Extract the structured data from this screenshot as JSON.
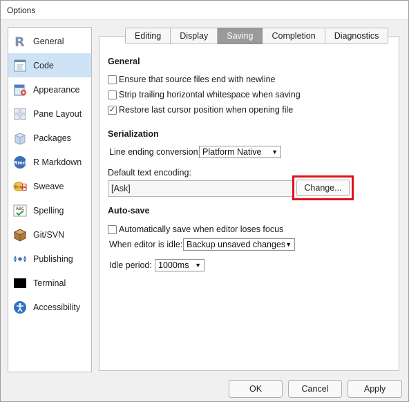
{
  "window": {
    "title": "Options"
  },
  "sidebar": {
    "items": [
      {
        "label": "General",
        "icon": "r-logo-icon"
      },
      {
        "label": "Code",
        "icon": "code-icon",
        "selected": true
      },
      {
        "label": "Appearance",
        "icon": "appearance-icon"
      },
      {
        "label": "Pane Layout",
        "icon": "pane-layout-icon"
      },
      {
        "label": "Packages",
        "icon": "packages-icon"
      },
      {
        "label": "R Markdown",
        "icon": "rmd-icon"
      },
      {
        "label": "Sweave",
        "icon": "sweave-icon"
      },
      {
        "label": "Spelling",
        "icon": "spelling-icon"
      },
      {
        "label": "Git/SVN",
        "icon": "git-box-icon"
      },
      {
        "label": "Publishing",
        "icon": "publishing-icon"
      },
      {
        "label": "Terminal",
        "icon": "terminal-icon"
      },
      {
        "label": "Accessibility",
        "icon": "accessibility-icon"
      }
    ],
    "rmd_icon_text": "Rmd",
    "rnw_icon_text": "Rnw",
    "abc_icon_text": "ABC"
  },
  "tabs": [
    {
      "label": "Editing"
    },
    {
      "label": "Display"
    },
    {
      "label": "Saving",
      "active": true
    },
    {
      "label": "Completion"
    },
    {
      "label": "Diagnostics"
    }
  ],
  "general": {
    "title": "General",
    "options": [
      {
        "label": "Ensure that source files end with newline",
        "checked": false
      },
      {
        "label": "Strip trailing horizontal whitespace when saving",
        "checked": false
      },
      {
        "label": "Restore last cursor position when opening file",
        "checked": true
      }
    ]
  },
  "serialization": {
    "title": "Serialization",
    "line_ending_label": "Line ending conversion:",
    "line_ending_value": "Platform Native",
    "encoding_label": "Default text encoding:",
    "encoding_value": "[Ask]",
    "change_label": "Change..."
  },
  "autosave": {
    "title": "Auto-save",
    "option_label": "Automatically save when editor loses focus",
    "option_checked": false,
    "idle_label": "When editor is idle:",
    "idle_value": "Backup unsaved changes",
    "period_label": "Idle period:",
    "period_value": "1000ms"
  },
  "footer": {
    "ok": "OK",
    "cancel": "Cancel",
    "apply": "Apply"
  },
  "colors": {
    "selected_bg": "#cfe3f7",
    "active_tab": "#9a9a9a",
    "highlight": "#e0101a",
    "r_blue": "#2b6cb3"
  }
}
